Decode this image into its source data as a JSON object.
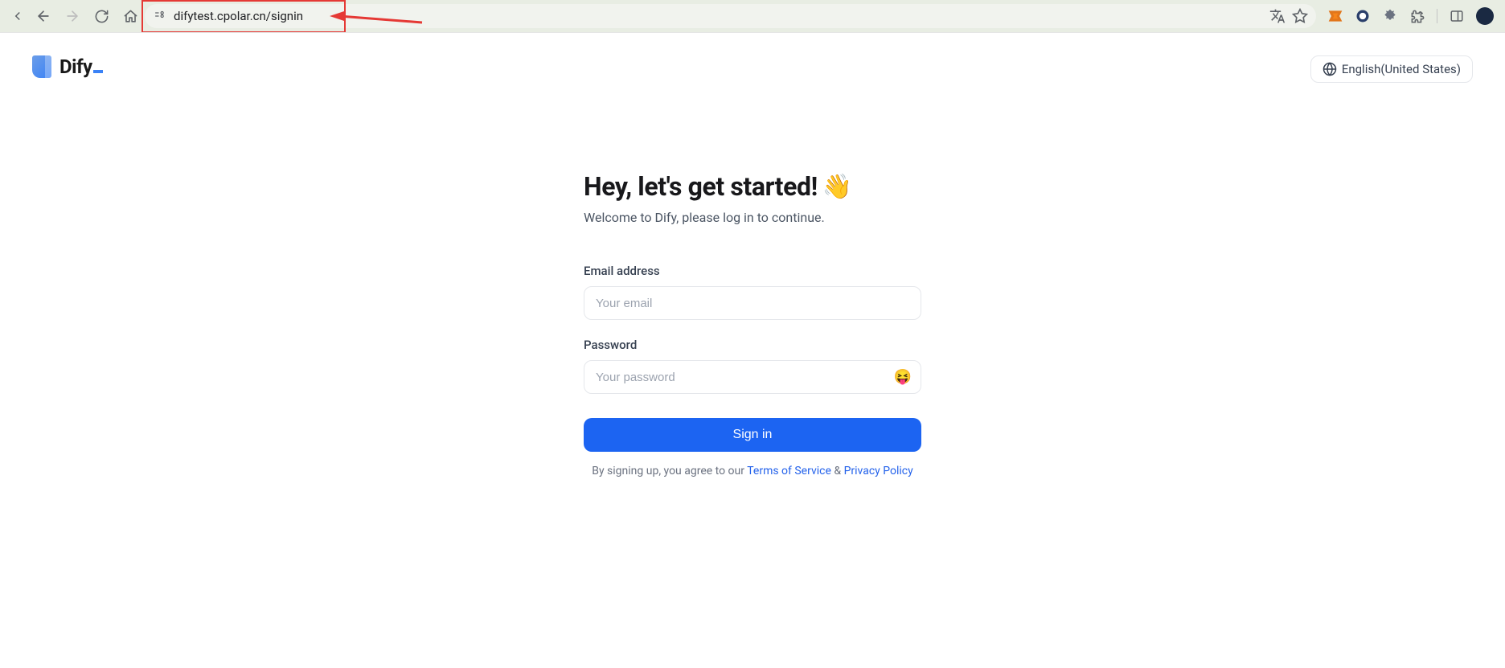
{
  "browser": {
    "url": "difytest.cpolar.cn/signin"
  },
  "header": {
    "brand": "Dify",
    "language": "English(United States)"
  },
  "signin": {
    "headline": "Hey, let's get started!",
    "wave": "👋",
    "subline": "Welcome to Dify, please log in to continue.",
    "email_label": "Email address",
    "email_placeholder": "Your email",
    "password_label": "Password",
    "password_placeholder": "Your password",
    "password_toggle_emoji": "😝",
    "submit_label": "Sign in",
    "terms_prefix": "By signing up, you agree to our ",
    "terms_link": "Terms of Service",
    "terms_conj": " & ",
    "privacy_link": "Privacy Policy"
  }
}
